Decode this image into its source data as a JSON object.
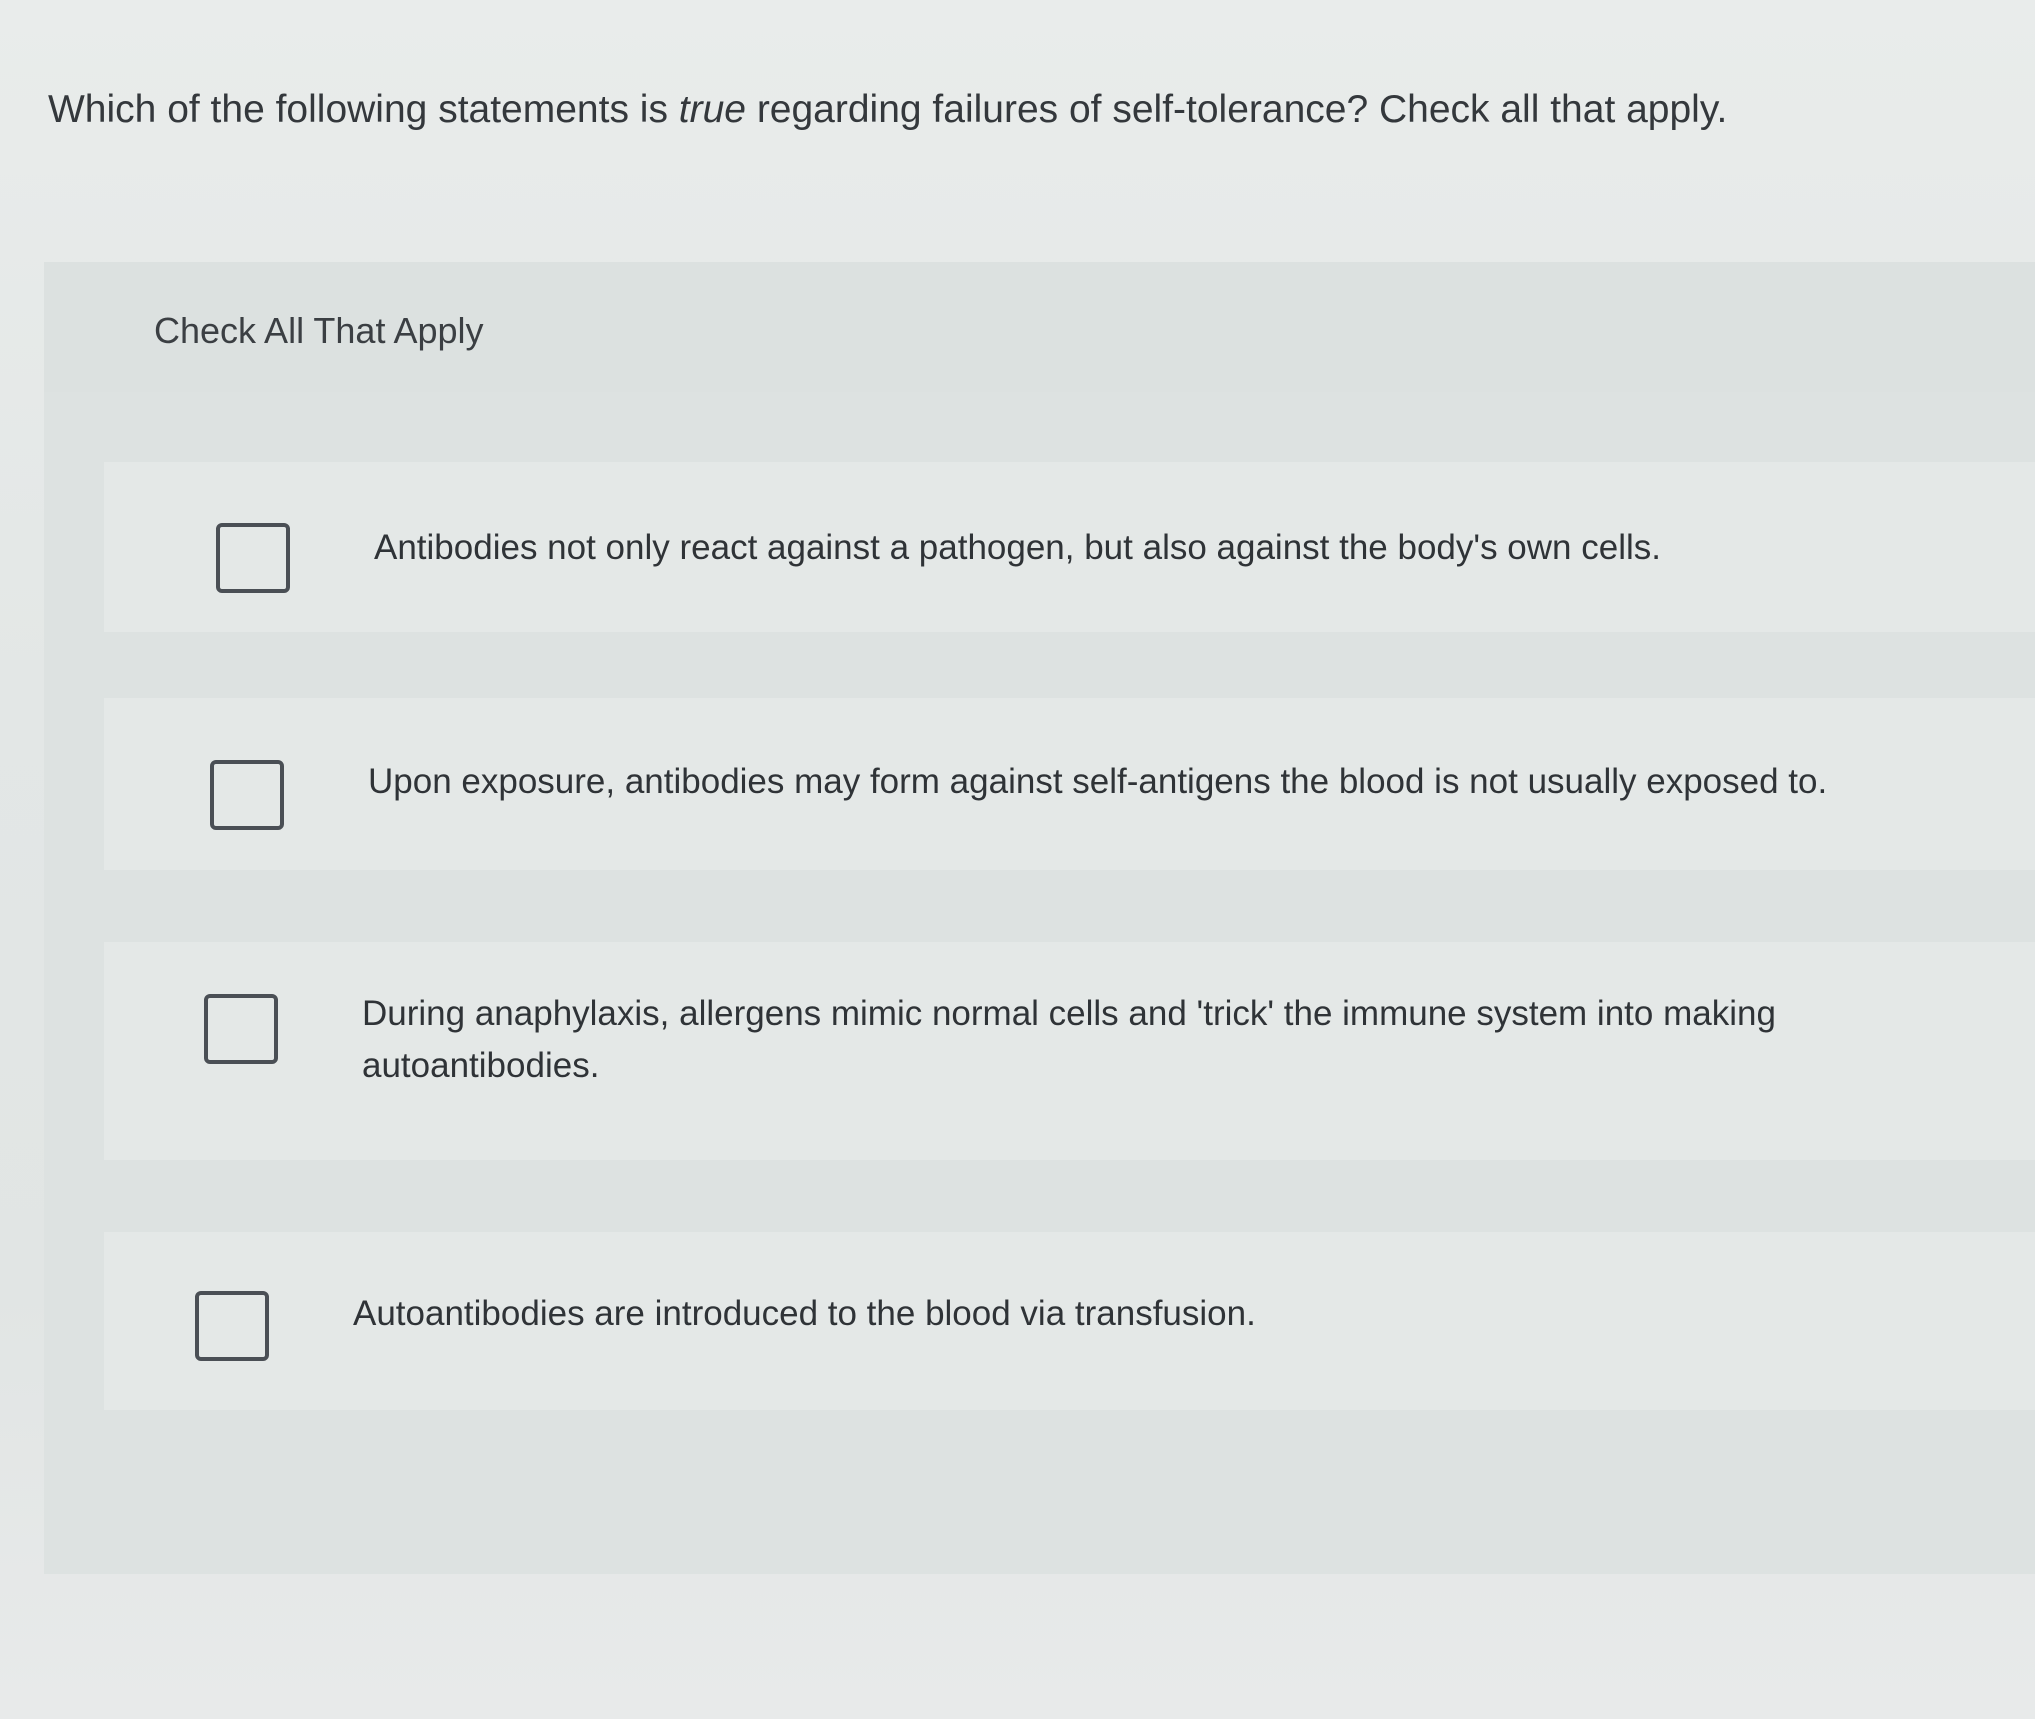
{
  "question": {
    "before": "Which of the following statements is ",
    "emphasis": "true",
    "after": " regarding failures of self-tolerance?  Check all that apply."
  },
  "instruction": "Check All That Apply",
  "options": [
    {
      "text": "Antibodies not only react against a pathogen, but also against the body's own cells.",
      "checked": false
    },
    {
      "text": "Upon exposure, antibodies may form against self-antigens the blood is not usually exposed to.",
      "checked": false
    },
    {
      "text": "During anaphylaxis, allergens mimic normal cells and 'trick' the immune system into making autoantibodies.",
      "checked": false
    },
    {
      "text": "Autoantibodies are introduced to the blood via transfusion.",
      "checked": false
    }
  ]
}
